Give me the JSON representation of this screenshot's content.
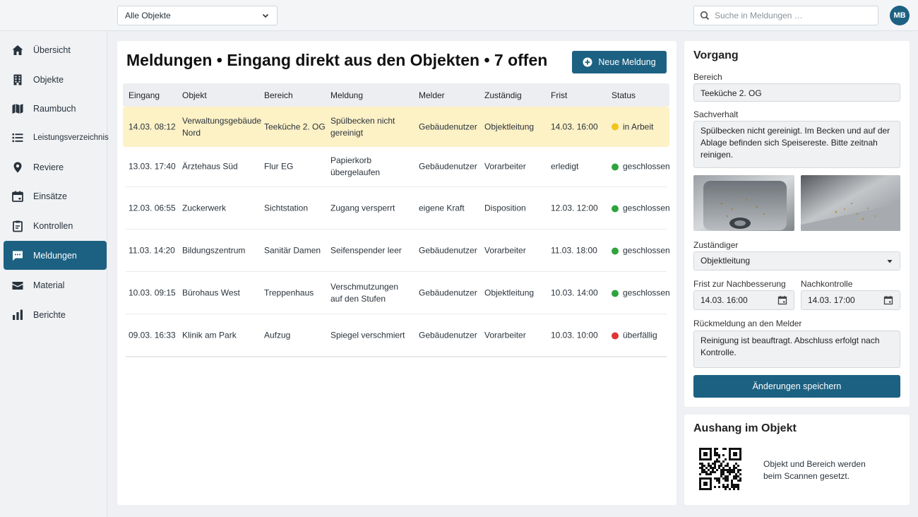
{
  "topbar": {
    "filter_value": "Alle Objekte",
    "search_placeholder": "Suche in Meldungen …",
    "user_initials": "MB"
  },
  "sidebar": {
    "items": [
      {
        "label": "Übersicht",
        "icon": "home-icon"
      },
      {
        "label": "Objekte",
        "icon": "building-icon"
      },
      {
        "label": "Raumbuch",
        "icon": "map-icon"
      },
      {
        "label": "Leistungsverzeichnis",
        "icon": "list-icon"
      },
      {
        "label": "Reviere",
        "icon": "location-pin-icon"
      },
      {
        "label": "Einsätze",
        "icon": "calendar-icon"
      },
      {
        "label": "Kontrollen",
        "icon": "clipboard-icon"
      },
      {
        "label": "Meldungen",
        "icon": "chat-icon",
        "active": true
      },
      {
        "label": "Material",
        "icon": "box-icon"
      },
      {
        "label": "Berichte",
        "icon": "bar-chart-icon"
      }
    ]
  },
  "main": {
    "title": "Meldungen • Eingang direkt aus den Objekten • 7 offen",
    "new_button": "Neue Meldung",
    "columns": [
      "Eingang",
      "Objekt",
      "Bereich",
      "Meldung",
      "Melder",
      "Zuständig",
      "Frist",
      "Status"
    ],
    "rows": [
      {
        "eingang": "14.03. 08:12",
        "objekt": "Verwaltungsgebäude Nord",
        "bereich": "Teeküche 2. OG",
        "meldung": "Spülbecken nicht gereinigt",
        "melder": "Gebäudenutzer",
        "zustaendig": "Objektleitung",
        "frist": "14.03. 16:00",
        "status": "in Arbeit",
        "status_color": "#f0c419"
      },
      {
        "eingang": "13.03. 17:40",
        "objekt": "Ärztehaus Süd",
        "bereich": "Flur EG",
        "meldung": "Papierkorb übergelaufen",
        "melder": "Gebäudenutzer",
        "zustaendig": "Vorarbeiter",
        "frist": "erledigt",
        "status": "geschlossen",
        "status_color": "#2fa33d"
      },
      {
        "eingang": "12.03. 06:55",
        "objekt": "Zuckerwerk",
        "bereich": "Sichtstation",
        "meldung": "Zugang versperrt",
        "melder": "eigene Kraft",
        "zustaendig": "Disposition",
        "frist": "12.03. 12:00",
        "status": "geschlossen",
        "status_color": "#2fa33d"
      },
      {
        "eingang": "11.03. 14:20",
        "objekt": "Bildungszentrum",
        "bereich": "Sanitär Damen",
        "meldung": "Seifenspender leer",
        "melder": "Gebäudenutzer",
        "zustaendig": "Vorarbeiter",
        "frist": "11.03. 18:00",
        "status": "geschlossen",
        "status_color": "#2fa33d"
      },
      {
        "eingang": "10.03. 09:15",
        "objekt": "Bürohaus West",
        "bereich": "Treppenhaus",
        "meldung": "Verschmutzungen auf den Stufen",
        "melder": "Gebäudenutzer",
        "zustaendig": "Objektleitung",
        "frist": "10.03. 14:00",
        "status": "geschlossen",
        "status_color": "#2fa33d"
      },
      {
        "eingang": "09.03. 16:33",
        "objekt": "Klinik am Park",
        "bereich": "Aufzug",
        "meldung": "Spiegel verschmiert",
        "melder": "Gebäudenutzer",
        "zustaendig": "Vorarbeiter",
        "frist": "10.03. 10:00",
        "status": "überfällig",
        "status_color": "#e03434"
      }
    ]
  },
  "vorgang": {
    "title": "Vorgang",
    "bereich_label": "Bereich",
    "bereich_value": "Teeküche 2. OG",
    "sachverhalt_label": "Sachverhalt",
    "sachverhalt_value": "Spülbecken nicht gereinigt. Im Becken und auf der Ablage befinden sich Speisereste. Bitte zeitnah reinigen.",
    "zustaendiger_label": "Zuständiger",
    "zustaendiger_value": "Objektleitung",
    "frist_label": "Frist zur Nachbesserung",
    "frist_value": "14.03. 16:00",
    "nachkontrolle_label": "Nachkontrolle",
    "nachkontrolle_value": "14.03. 17:00",
    "rueckmeldung_label": "Rückmeldung an den Melder",
    "rueckmeldung_value": "Reinigung ist beauftragt. Abschluss erfolgt nach Kontrolle.",
    "save_button": "Änderungen speichern"
  },
  "aushang": {
    "title": "Aushang im Objekt",
    "text": "Objekt und Bereich werden beim Scannen gesetzt."
  },
  "colors": {
    "accent": "#1c6182",
    "selected_row": "#fdf1c6",
    "status_in_progress": "#f0c419",
    "status_closed": "#2fa33d",
    "status_overdue": "#e03434"
  }
}
